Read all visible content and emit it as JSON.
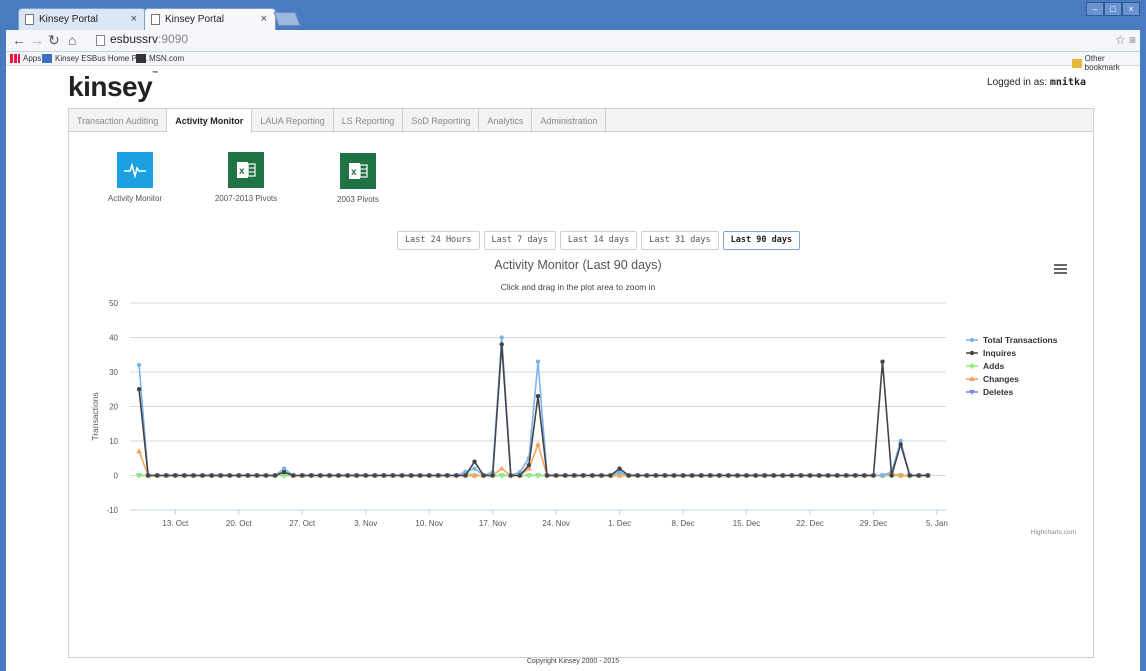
{
  "browser": {
    "tabs": [
      {
        "label": "Kinsey Portal"
      },
      {
        "label": "Kinsey Portal"
      }
    ],
    "url_host": "esbussrv",
    "url_port": ":9090",
    "bookmarks": {
      "apps": "Apps",
      "esb": "Kinsey ESBus Home Pa...",
      "msn": "MSN.com",
      "other": "Other bookmark"
    }
  },
  "header": {
    "logo": "kinsey",
    "login_prefix": "Logged in as:",
    "username": "mnitka"
  },
  "nav": {
    "tabs": [
      {
        "label": "Transaction Auditing"
      },
      {
        "label": "Activity Monitor"
      },
      {
        "label": "LAUA Reporting"
      },
      {
        "label": "LS Reporting"
      },
      {
        "label": "SoD Reporting"
      },
      {
        "label": "Analytics"
      },
      {
        "label": "Administration"
      }
    ],
    "active_index": 1
  },
  "tiles": [
    {
      "label": "Activity Monitor",
      "icon": "activity-pulse-icon",
      "color": "#1ba1e2"
    },
    {
      "label": "2007-2013 Pivots",
      "icon": "excel-icon",
      "color": "#217346"
    },
    {
      "label": "2003 Pivots",
      "icon": "excel-icon",
      "color": "#217346"
    }
  ],
  "range_buttons": [
    "Last 24 Hours",
    "Last 7 days",
    "Last 14 days",
    "Last 31 days",
    "Last 90 days"
  ],
  "active_range_index": 4,
  "footer": {
    "copyright": "Copyright Kinsey 2000 - 2015"
  },
  "chart_data": {
    "type": "line",
    "title": "Activity Monitor (Last 90 days)",
    "subtitle": "Click and drag in the plot area to zoom in",
    "xlabel": "",
    "ylabel": "Transactions",
    "ylim": [
      -10,
      50
    ],
    "yticks": [
      -10,
      0,
      10,
      20,
      30,
      40,
      50
    ],
    "xlim": [
      "2015-10-08",
      "2016-01-06"
    ],
    "xticks": [
      {
        "date": "2015-10-13",
        "label": "13. Oct"
      },
      {
        "date": "2015-10-20",
        "label": "20. Oct"
      },
      {
        "date": "2015-10-27",
        "label": "27. Oct"
      },
      {
        "date": "2015-11-03",
        "label": "3. Nov"
      },
      {
        "date": "2015-11-10",
        "label": "10. Nov"
      },
      {
        "date": "2015-11-17",
        "label": "17. Nov"
      },
      {
        "date": "2015-11-24",
        "label": "24. Nov"
      },
      {
        "date": "2015-12-01",
        "label": "1. Dec"
      },
      {
        "date": "2015-12-08",
        "label": "8. Dec"
      },
      {
        "date": "2015-12-15",
        "label": "15. Dec"
      },
      {
        "date": "2015-12-22",
        "label": "22. Dec"
      },
      {
        "date": "2015-12-29",
        "label": "29. Dec"
      },
      {
        "date": "2016-01-05",
        "label": "5. Jan"
      }
    ],
    "grid": true,
    "legend_position": "right",
    "credits": "Highcharts.com",
    "series": [
      {
        "name": "Total Transactions",
        "color": "#7cb5ec",
        "marker": "circle",
        "points": [
          [
            "2015-10-09",
            32
          ],
          [
            "2015-10-25",
            2
          ],
          [
            "2015-11-14",
            1
          ],
          [
            "2015-11-15",
            2
          ],
          [
            "2015-11-17",
            1
          ],
          [
            "2015-11-18",
            40
          ],
          [
            "2015-11-20",
            1
          ],
          [
            "2015-11-21",
            5
          ],
          [
            "2015-11-22",
            33
          ],
          [
            "2015-12-01",
            1
          ],
          [
            "2015-12-31",
            1
          ],
          [
            "2016-01-01",
            10
          ]
        ]
      },
      {
        "name": "Inquires",
        "color": "#434348",
        "marker": "circle",
        "points": [
          [
            "2015-10-09",
            25
          ],
          [
            "2015-10-25",
            1
          ],
          [
            "2015-11-15",
            4
          ],
          [
            "2015-11-18",
            38
          ],
          [
            "2015-11-21",
            3
          ],
          [
            "2015-11-22",
            23
          ],
          [
            "2015-12-01",
            2
          ],
          [
            "2015-12-30",
            33
          ],
          [
            "2016-01-01",
            9
          ]
        ]
      },
      {
        "name": "Adds",
        "color": "#90ed7d",
        "marker": "diamond",
        "points": [
          [
            "2015-11-14",
            1
          ]
        ]
      },
      {
        "name": "Changes",
        "color": "#f7a35c",
        "marker": "triangle",
        "points": [
          [
            "2015-10-09",
            7
          ],
          [
            "2015-10-25",
            1
          ],
          [
            "2015-11-18",
            2
          ],
          [
            "2015-11-21",
            2
          ],
          [
            "2015-11-22",
            9
          ],
          [
            "2015-12-31",
            0.5
          ]
        ]
      },
      {
        "name": "Deletes",
        "color": "#8085e9",
        "marker": "triangle-down",
        "points": []
      }
    ]
  }
}
